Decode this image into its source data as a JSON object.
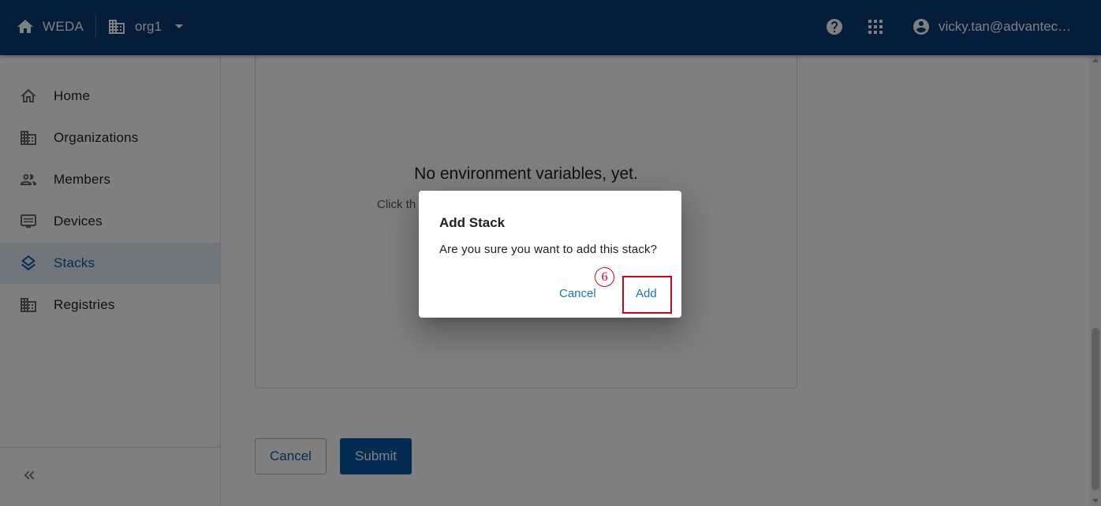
{
  "topbar": {
    "home_label": "WEDA",
    "org_label": "org1",
    "user_label": "vicky.tan@advantec…",
    "icons": [
      "home-icon",
      "building-icon",
      "caret-down-icon",
      "help-icon",
      "apps-grid-icon",
      "account-circle-icon"
    ]
  },
  "sidebar": {
    "items": [
      {
        "label": "Home",
        "icon": "home-outline-icon"
      },
      {
        "label": "Organizations",
        "icon": "building-icon"
      },
      {
        "label": "Members",
        "icon": "members-icon"
      },
      {
        "label": "Devices",
        "icon": "devices-icon"
      },
      {
        "label": "Stacks",
        "icon": "layers-icon",
        "active": true
      },
      {
        "label": "Registries",
        "icon": "building-icon"
      }
    ],
    "collapse_icon": "double-chevron-left-icon"
  },
  "main": {
    "empty_title": "No environment variables, yet.",
    "empty_hint": "Click th",
    "cancel_label": "Cancel",
    "submit_label": "Submit"
  },
  "dialog": {
    "title": "Add Stack",
    "message": "Are you sure you want to add this stack?",
    "cancel_label": "Cancel",
    "add_label": "Add",
    "step_number": "6"
  },
  "colors": {
    "topbar": "#063a76",
    "primary": "#0b5aa7",
    "active_bg": "#e3ecf5",
    "highlight": "#d0021b"
  }
}
